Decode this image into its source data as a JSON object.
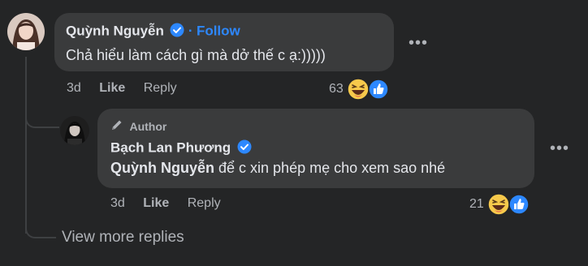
{
  "comment": {
    "author": "Quỳnh Nguyễn",
    "follow_sep": "·",
    "follow_label": "Follow",
    "text": "Chả hiểu làm cách gì mà dở thế c ạ:)))))",
    "time": "3d",
    "like_label": "Like",
    "reply_label": "Reply",
    "reaction_count": "63",
    "reaction_icons": [
      "haha-icon",
      "like-icon"
    ]
  },
  "reply": {
    "badge": "Author",
    "author": "Bạch Lan Phương",
    "mention": "Quỳnh Nguyễn",
    "text": " để c xin phép mẹ cho xem sao nhé",
    "time": "3d",
    "like_label": "Like",
    "reply_label": "Reply",
    "reaction_count": "21",
    "reaction_icons": [
      "haha-icon",
      "like-icon"
    ]
  },
  "view_more_label": "View more replies",
  "colors": {
    "background": "#242526",
    "bubble": "#3a3b3c",
    "accent": "#2d88ff",
    "secondary_text": "#b0b3b8"
  }
}
